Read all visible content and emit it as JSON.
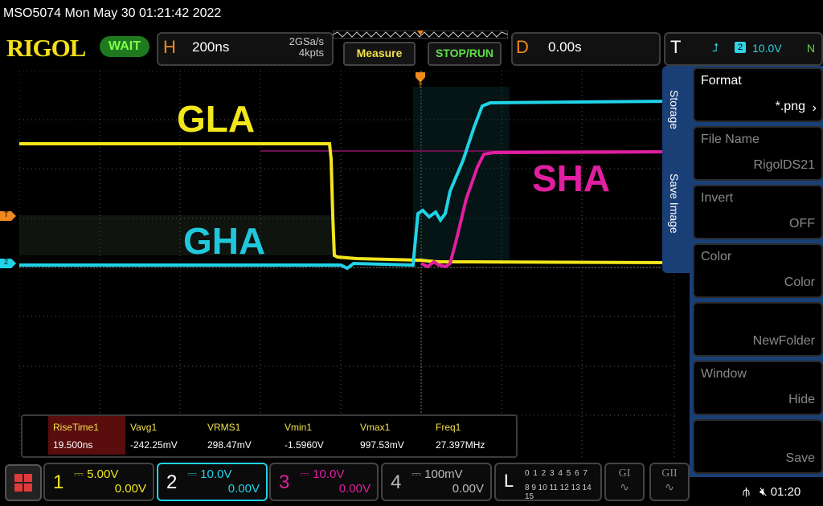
{
  "titlebar": {
    "text": "MSO5074  Mon May 30 01:21:42 2022"
  },
  "header": {
    "logo": "RIGOL",
    "run_state": "WAIT",
    "horizontal": {
      "letter": "H",
      "timebase": "200ns",
      "sample_rate": "2GSa/s",
      "memory_depth": "4kpts"
    },
    "measure_label": "Measure",
    "stoprun_label": "STOP/RUN",
    "delay": {
      "letter": "D",
      "value": "0.00s"
    },
    "trigger": {
      "letter": "T",
      "channel": "2",
      "level": "10.0V",
      "mode": "N",
      "edge_icon": "rising-edge-icon"
    }
  },
  "waveform_labels": {
    "gla": "GLA",
    "gha": "GHA",
    "sha": "SHA"
  },
  "markers": {
    "trigger_level": "T",
    "ch2_ground": "2"
  },
  "colors": {
    "ch1": "#f3e61b",
    "ch2": "#20d3e8",
    "ch3": "#e01fa0",
    "ch4": "#bbbbbb",
    "accent": "#f08a1c",
    "menu": "#1a3f77"
  },
  "measurements": [
    {
      "name": "RiseTime1",
      "value": "19.500ns"
    },
    {
      "name": "Vavg1",
      "value": "-242.25mV"
    },
    {
      "name": "VRMS1",
      "value": "298.47mV"
    },
    {
      "name": "Vmin1",
      "value": "-1.5960V"
    },
    {
      "name": "Vmax1",
      "value": "997.53mV"
    },
    {
      "name": "Freq1",
      "value": "27.397MHz"
    }
  ],
  "side_tabs": {
    "storage": "Storage",
    "save_image": "Save Image"
  },
  "menu": [
    {
      "name": "Format",
      "value": "*.png"
    },
    {
      "name": "File Name",
      "value": "RigolDS21"
    },
    {
      "name": "Invert",
      "value": "OFF"
    },
    {
      "name": "Color",
      "value": "Color"
    },
    {
      "name": "",
      "value": "NewFolder"
    },
    {
      "name": "Window",
      "value": "Hide"
    },
    {
      "name": "",
      "value": "Save"
    }
  ],
  "channels": [
    {
      "num": "1",
      "scale": "5.00V",
      "offset": "0.00V"
    },
    {
      "num": "2",
      "scale": "10.0V",
      "offset": "0.00V"
    },
    {
      "num": "3",
      "scale": "10.0V",
      "offset": "0.00V"
    },
    {
      "num": "4",
      "scale": "100mV",
      "offset": "0.00V"
    }
  ],
  "logic": {
    "letter": "L",
    "row1": "0 1 2 3  4 5 6 7",
    "row2": "8 9 10 11 12 13 14 15"
  },
  "gen_buttons": [
    "GI",
    "GII"
  ],
  "status": {
    "time": "01:20"
  }
}
